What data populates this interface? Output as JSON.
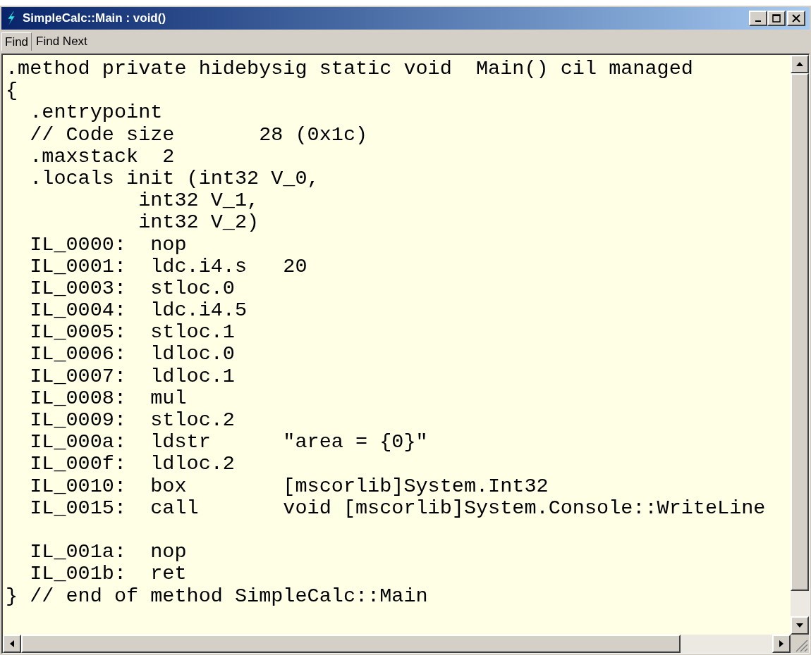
{
  "window": {
    "title": "SimpleCalc::Main : void()"
  },
  "toolbar": {
    "buttons": [
      "Find",
      "Find Next"
    ]
  },
  "code": {
    "blocks": [
      [
        ".method private hidebysig static void  Main() cil managed",
        "{",
        "  .entrypoint",
        "  // Code size       28 (0x1c)",
        "  .maxstack  2",
        "  .locals init (int32 V_0,",
        "           int32 V_1,",
        "           int32 V_2)",
        "  IL_0000:  nop",
        "  IL_0001:  ldc.i4.s   20",
        "  IL_0003:  stloc.0",
        "  IL_0004:  ldc.i4.5",
        "  IL_0005:  stloc.1",
        "  IL_0006:  ldloc.0",
        "  IL_0007:  ldloc.1",
        "  IL_0008:  mul",
        "  IL_0009:  stloc.2",
        "  IL_000a:  ldstr      \"area = {0}\"",
        "  IL_000f:  ldloc.2",
        "  IL_0010:  box        [mscorlib]System.Int32",
        "  IL_0015:  call       void [mscorlib]System.Console::WriteLine"
      ],
      [
        "  IL_001a:  nop",
        "  IL_001b:  ret",
        "} // end of method SimpleCalc::Main"
      ]
    ]
  }
}
